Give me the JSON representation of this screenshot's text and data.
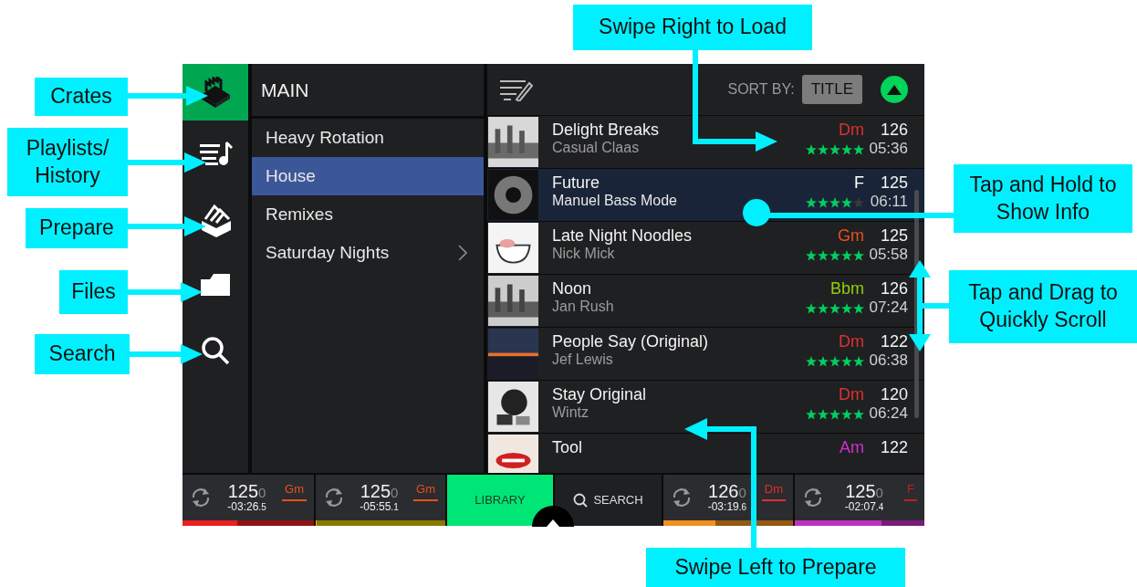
{
  "sidebar": {
    "items": [
      {
        "kind": "crates",
        "selected": true
      },
      {
        "kind": "playlists",
        "selected": false
      },
      {
        "kind": "prepare",
        "selected": false
      },
      {
        "kind": "files",
        "selected": false
      },
      {
        "kind": "search",
        "selected": false
      }
    ]
  },
  "crates": {
    "title": "MAIN",
    "items": [
      {
        "label": "Heavy Rotation",
        "selected": false,
        "has_children": false
      },
      {
        "label": "House",
        "selected": true,
        "has_children": false
      },
      {
        "label": "Remixes",
        "selected": false,
        "has_children": false
      },
      {
        "label": "Saturday Nights",
        "selected": false,
        "has_children": true
      }
    ]
  },
  "tracklist": {
    "sort_label": "SORT BY:",
    "sort_value": "TITLE",
    "rows": [
      {
        "title": "Delight Breaks",
        "artist": "Casual Claas",
        "key": "Dm",
        "color": "#e03030",
        "bpm": "126",
        "time": "05:36",
        "stars": 5,
        "selected": false
      },
      {
        "title": "Future",
        "artist": "Manuel Bass Mode",
        "key": "F",
        "color": "#ffffff",
        "bpm": "125",
        "time": "06:11",
        "stars": 4,
        "selected": true
      },
      {
        "title": "Late Night Noodles",
        "artist": "Nick Mick",
        "key": "Gm",
        "color": "#e85020",
        "bpm": "125",
        "time": "05:58",
        "stars": 5,
        "selected": false
      },
      {
        "title": "Noon",
        "artist": "Jan Rush",
        "key": "Bbm",
        "color": "#90d010",
        "bpm": "126",
        "time": "07:24",
        "stars": 5,
        "selected": false
      },
      {
        "title": "People Say (Original)",
        "artist": "Jef Lewis",
        "key": "Dm",
        "color": "#e03030",
        "bpm": "122",
        "time": "06:38",
        "stars": 5,
        "selected": false
      },
      {
        "title": "Stay Original",
        "artist": "Wintz",
        "key": "Dm",
        "color": "#e03030",
        "bpm": "120",
        "time": "06:24",
        "stars": 5,
        "selected": false
      },
      {
        "title": "Tool",
        "key": "Am",
        "color": "#d030d0",
        "bpm": "122",
        "selected": false
      }
    ]
  },
  "bottom_bar": [
    {
      "kind": "deck",
      "bpm": "125",
      "bpm_decimal": "0",
      "time": "-03:26",
      "time_fraction": ".5",
      "key": {
        "label": "Gm",
        "color": "#e85020"
      },
      "progress": {
        "color": "#e82020",
        "level": 0.42
      }
    },
    {
      "kind": "deck",
      "bpm": "125",
      "bpm_decimal": "0",
      "time": "-05:55",
      "time_fraction": ".1",
      "key": {
        "label": "Gm",
        "color": "#e85020"
      },
      "progress": {
        "color": "#e0c000",
        "level": 0.01
      }
    },
    {
      "kind": "library",
      "label": "LIBRARY",
      "selected": true
    },
    {
      "kind": "search",
      "label": "SEARCH",
      "selected": false
    },
    {
      "kind": "deck",
      "bpm": "126",
      "bpm_decimal": "0",
      "time": "-03:19",
      "time_fraction": ".6",
      "key": {
        "label": "Dm",
        "color": "#e03030"
      },
      "progress": {
        "color": "#f09020",
        "level": 0.4
      }
    },
    {
      "kind": "deck",
      "bpm": "125",
      "bpm_decimal": "0",
      "time": "-02:07",
      "time_fraction": ".4",
      "key": {
        "label": "F",
        "color": "#c02020"
      },
      "progress": {
        "color": "#c030c0",
        "level": 0.67
      }
    }
  ],
  "callouts": [
    {
      "text": "Swipe Right to Load"
    },
    {
      "text": "Crates"
    },
    {
      "text": "Playlists/ History"
    },
    {
      "text": "Tap and Hold to Show Info"
    },
    {
      "text": "Prepare"
    },
    {
      "text": "Files"
    },
    {
      "text": "Tap and Drag to Quickly Scroll"
    },
    {
      "text": "Search"
    },
    {
      "text": "Swipe Left to Prepare"
    }
  ]
}
